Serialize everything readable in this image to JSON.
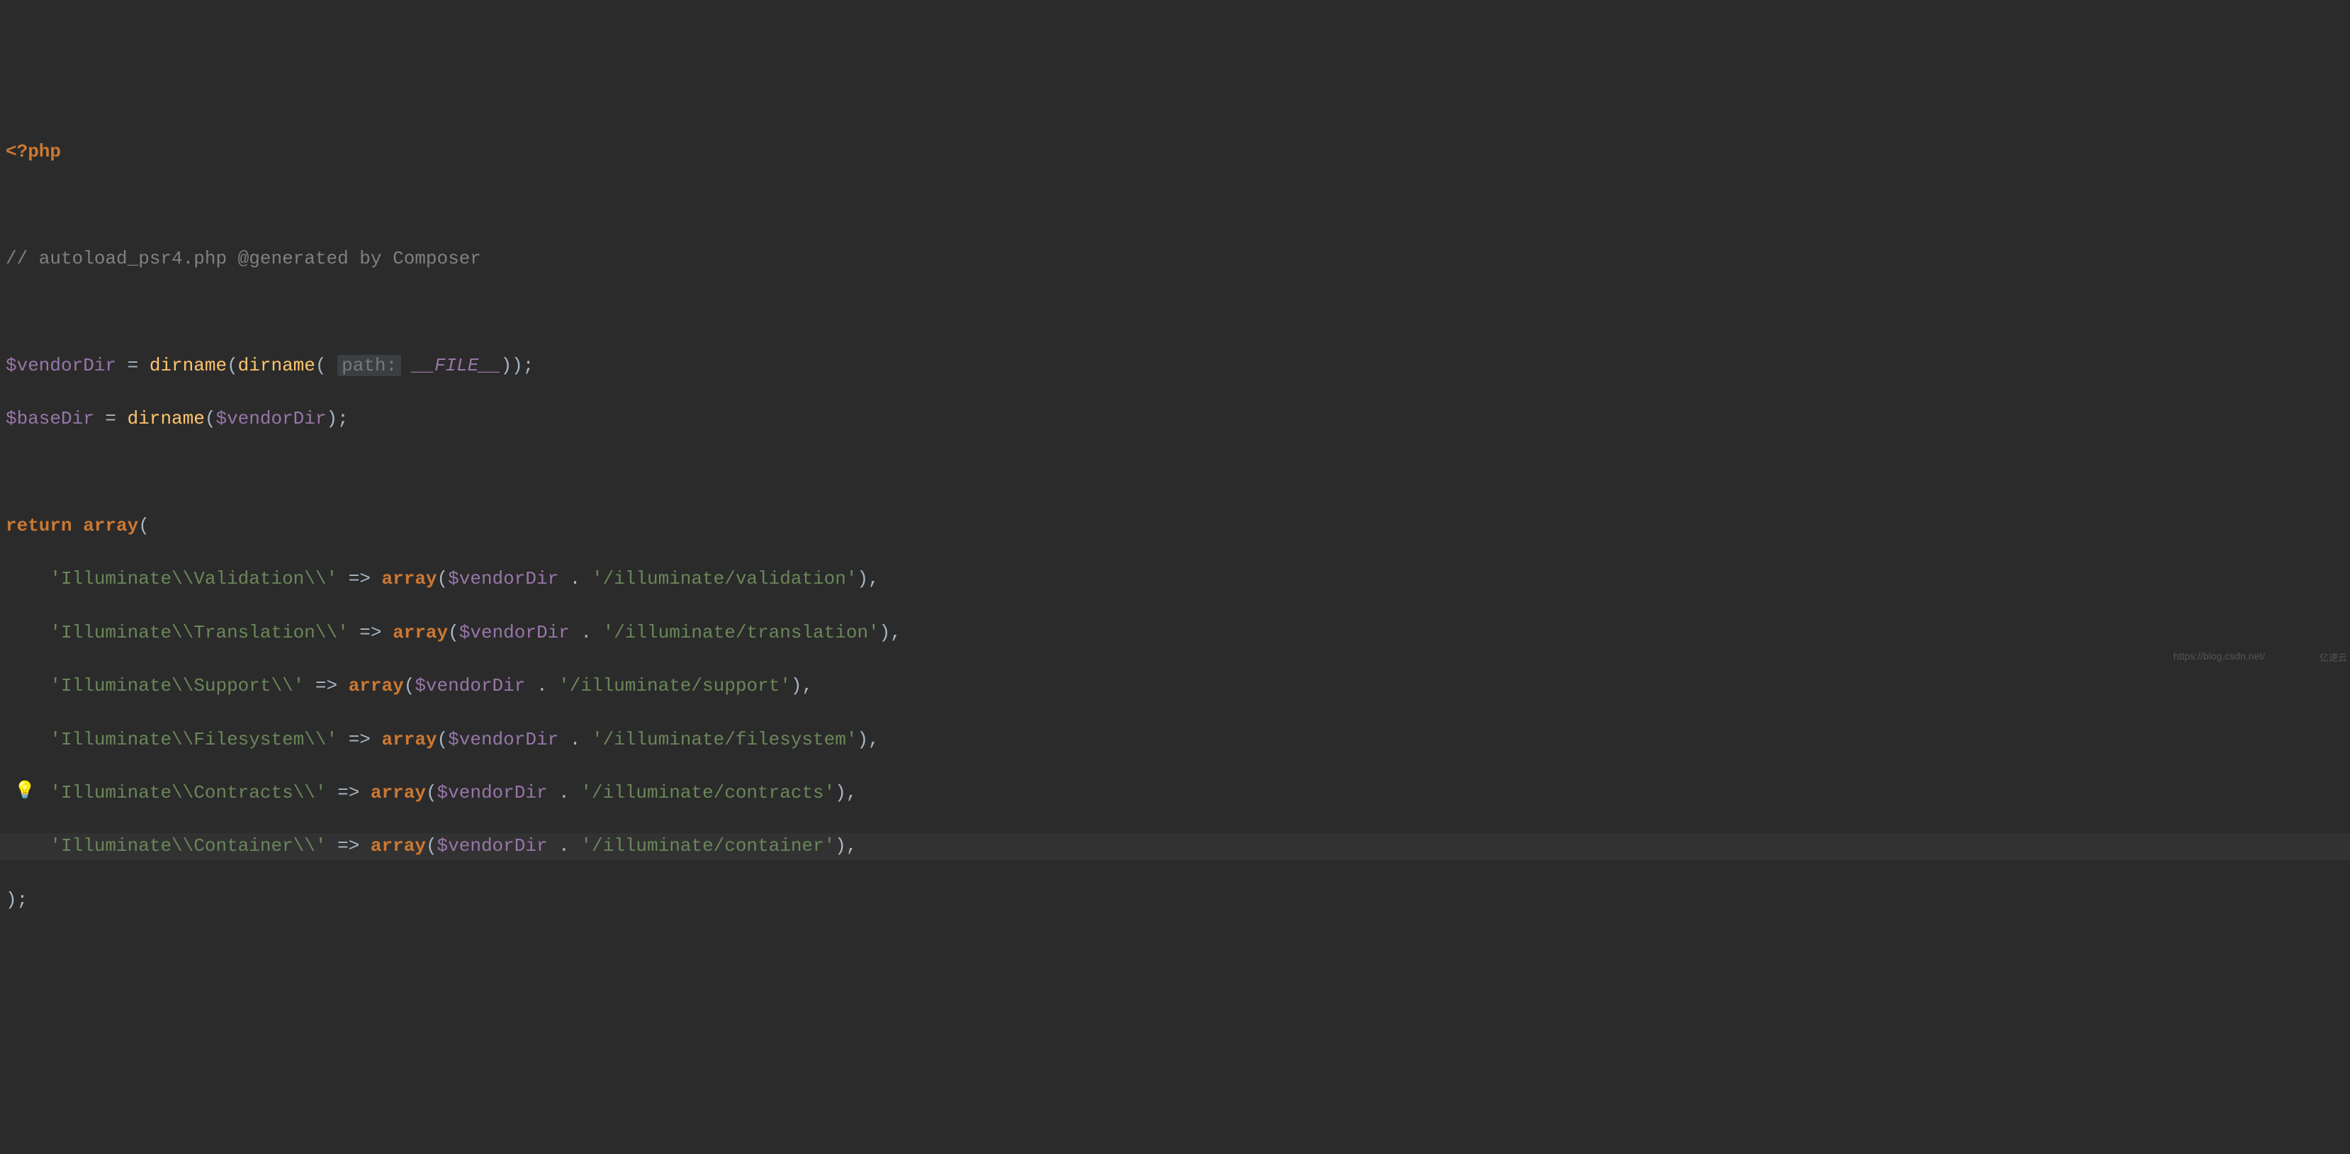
{
  "code": {
    "php_open": "<?php",
    "blank": "",
    "comment1": "// autoload_psr4.php @generated by Composer",
    "line_vendor": {
      "var1": "$vendorDir",
      "eq": " = ",
      "fn1": "dirname",
      "p1": "(",
      "fn2": "dirname",
      "p2": "( ",
      "hint": "path:",
      "sp": " ",
      "const": "__FILE__",
      "p3": "));"
    },
    "line_base": {
      "var1": "$baseDir",
      "eq": " = ",
      "fn1": "dirname",
      "p1": "(",
      "var2": "$vendorDir",
      "p2": ");"
    },
    "return_kw": "return",
    "array_kw": "array",
    "open_paren": "(",
    "entries": [
      {
        "key": "'Illuminate\\\\Validation\\\\'",
        "path": "'/illuminate/validation'"
      },
      {
        "key": "'Illuminate\\\\Translation\\\\'",
        "path": "'/illuminate/translation'"
      },
      {
        "key": "'Illuminate\\\\Support\\\\'",
        "path": "'/illuminate/support'"
      },
      {
        "key": "'Illuminate\\\\Filesystem\\\\'",
        "path": "'/illuminate/filesystem'"
      },
      {
        "key": "'Illuminate\\\\Contracts\\\\'",
        "path": "'/illuminate/contracts'"
      },
      {
        "key": "'Illuminate\\\\Container\\\\'",
        "path": "'/illuminate/container'"
      }
    ],
    "arrow": " => ",
    "vendor_var": "$vendorDir",
    "concat": " . ",
    "close": ");",
    "comma": ","
  },
  "icons": {
    "bulb": "💡"
  },
  "watermark": "https://blog.csdn.net/",
  "corner": "亿速云"
}
